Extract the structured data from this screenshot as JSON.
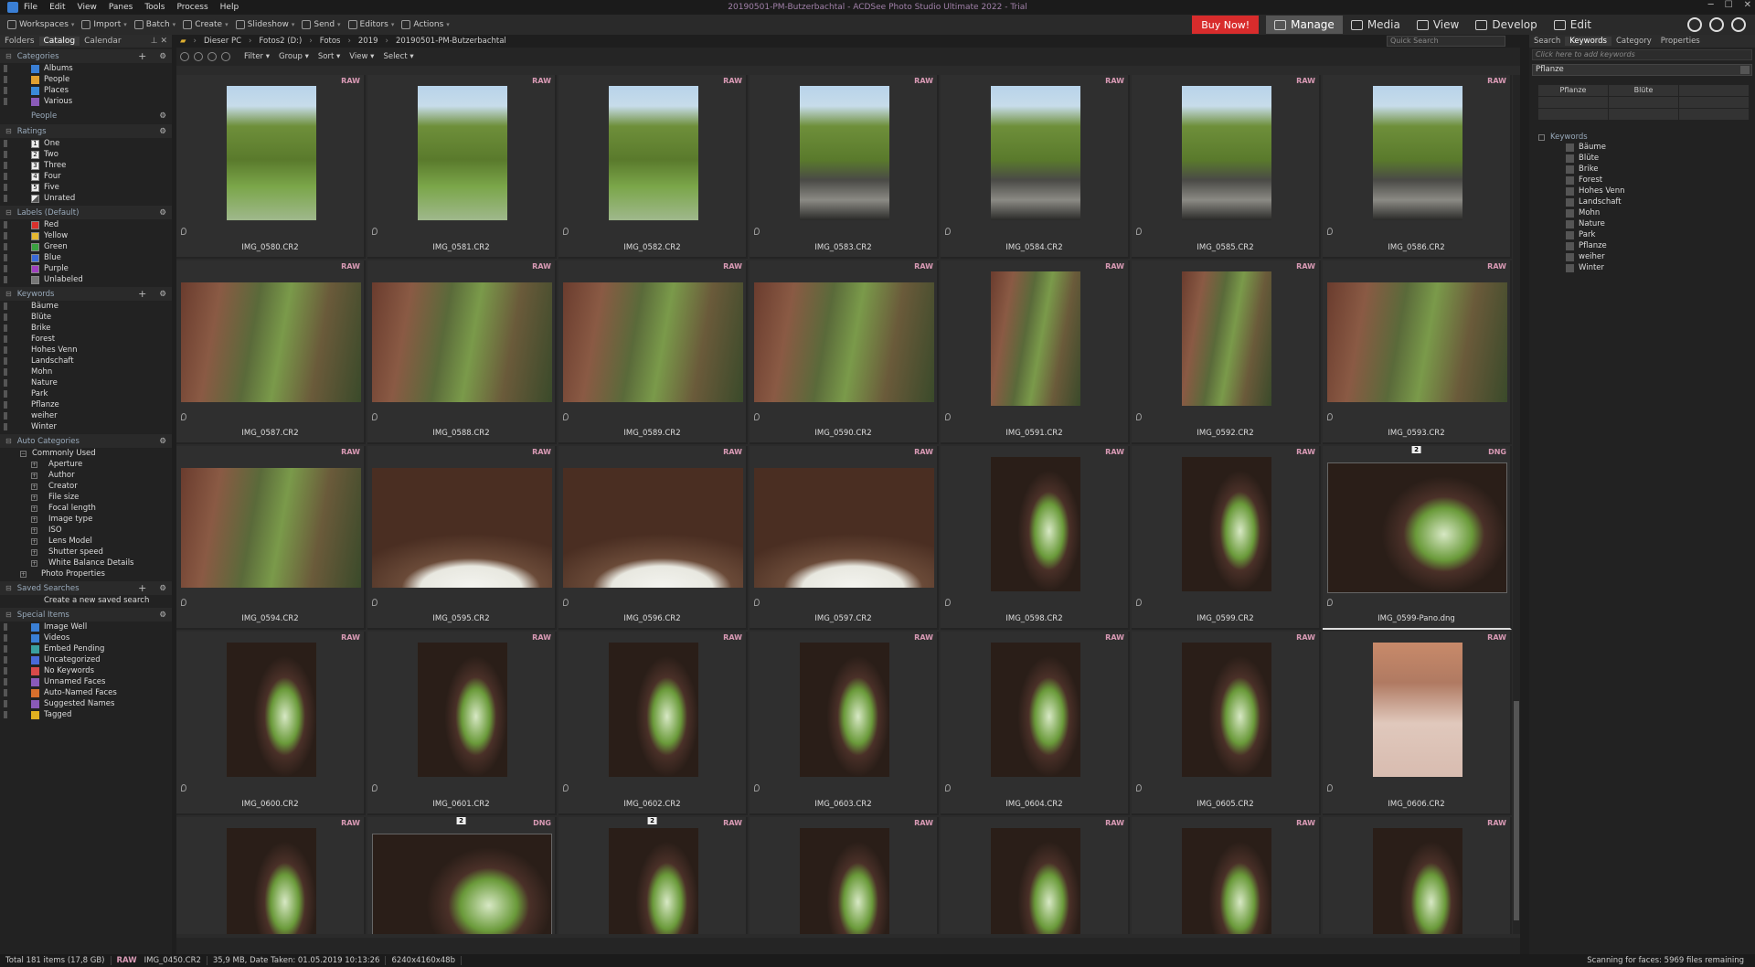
{
  "window": {
    "title": "20190501-PM-Butzerbachtal - ACDSee Photo Studio Ultimate 2022 - Trial",
    "menu": [
      "File",
      "Edit",
      "View",
      "Panes",
      "Tools",
      "Process",
      "Help"
    ]
  },
  "toolbar": {
    "items": [
      "Workspaces",
      "Import",
      "Batch",
      "Create",
      "Slideshow",
      "Send",
      "Editors",
      "Actions"
    ],
    "buy_now": "Buy Now!",
    "modes": [
      "Manage",
      "Media",
      "View",
      "Develop",
      "Edit"
    ],
    "active_mode": "Manage"
  },
  "left_panel": {
    "tabs": [
      "Folders",
      "Catalog",
      "Calendar"
    ],
    "active_tab": "Catalog",
    "categories": {
      "title": "Categories",
      "items": [
        "Albums",
        "People",
        "Places",
        "Various"
      ]
    },
    "people": {
      "title": "People"
    },
    "ratings": {
      "title": "Ratings",
      "items": [
        {
          "num": "1",
          "label": "One"
        },
        {
          "num": "2",
          "label": "Two"
        },
        {
          "num": "3",
          "label": "Three"
        },
        {
          "num": "4",
          "label": "Four"
        },
        {
          "num": "5",
          "label": "Five"
        },
        {
          "num": "",
          "label": "Unrated"
        }
      ]
    },
    "labels": {
      "title": "Labels (Default)",
      "items": [
        {
          "label": "Red",
          "color": "#d9302c"
        },
        {
          "label": "Yellow",
          "color": "#e6b830"
        },
        {
          "label": "Green",
          "color": "#3aa040"
        },
        {
          "label": "Blue",
          "color": "#3a6ad8"
        },
        {
          "label": "Purple",
          "color": "#a040c0"
        },
        {
          "label": "Unlabeled",
          "color": "#777777"
        }
      ]
    },
    "keywords": {
      "title": "Keywords",
      "items": [
        "Bäume",
        "Blüte",
        "Brike",
        "Forest",
        "Hohes Venn",
        "Landschaft",
        "Mohn",
        "Nature",
        "Park",
        "Pflanze",
        "weiher",
        "Winter"
      ]
    },
    "auto_categories": {
      "title": "Auto Categories",
      "group": "Commonly Used",
      "items": [
        "Aperture",
        "Author",
        "Creator",
        "File size",
        "Focal length",
        "Image type",
        "ISO",
        "Lens Model",
        "Shutter speed",
        "White Balance Details"
      ],
      "extra": "Photo Properties"
    },
    "saved_searches": {
      "title": "Saved Searches",
      "items": [
        "Create a new saved search"
      ]
    },
    "special_items": {
      "title": "Special Items",
      "items": [
        "Image Well",
        "Videos",
        "Embed Pending",
        "Uncategorized",
        "No Keywords",
        "Unnamed Faces",
        "Auto-Named Faces",
        "Suggested Names",
        "Tagged"
      ]
    }
  },
  "path": {
    "segments": [
      "Dieser PC",
      "Fotos2 (D:)",
      "Fotos",
      "2019",
      "20190501-PM-Butzerbachtal"
    ],
    "quick_search_placeholder": "Quick Search"
  },
  "filterbar": [
    "Filter",
    "Group",
    "Sort",
    "View",
    "Select"
  ],
  "thumbnails": [
    {
      "name": "IMG_0580.CR2",
      "tag": "RAW",
      "kind": "land",
      "orient": "p"
    },
    {
      "name": "IMG_0581.CR2",
      "tag": "RAW",
      "kind": "land",
      "orient": "p"
    },
    {
      "name": "IMG_0582.CR2",
      "tag": "RAW",
      "kind": "land",
      "orient": "p"
    },
    {
      "name": "IMG_0583.CR2",
      "tag": "RAW",
      "kind": "landrock",
      "orient": "p"
    },
    {
      "name": "IMG_0584.CR2",
      "tag": "RAW",
      "kind": "landrock",
      "orient": "p"
    },
    {
      "name": "IMG_0585.CR2",
      "tag": "RAW",
      "kind": "landrock",
      "orient": "p"
    },
    {
      "name": "IMG_0586.CR2",
      "tag": "RAW",
      "kind": "landrock",
      "orient": "p"
    },
    {
      "name": "IMG_0587.CR2",
      "tag": "RAW",
      "kind": "rock",
      "orient": "l"
    },
    {
      "name": "IMG_0588.CR2",
      "tag": "RAW",
      "kind": "rock",
      "orient": "l"
    },
    {
      "name": "IMG_0589.CR2",
      "tag": "RAW",
      "kind": "rock",
      "orient": "l"
    },
    {
      "name": "IMG_0590.CR2",
      "tag": "RAW",
      "kind": "rock",
      "orient": "l"
    },
    {
      "name": "IMG_0591.CR2",
      "tag": "RAW",
      "kind": "rock",
      "orient": "p"
    },
    {
      "name": "IMG_0592.CR2",
      "tag": "RAW",
      "kind": "rock",
      "orient": "p"
    },
    {
      "name": "IMG_0593.CR2",
      "tag": "RAW",
      "kind": "rock",
      "orient": "l"
    },
    {
      "name": "IMG_0594.CR2",
      "tag": "RAW",
      "kind": "rock",
      "orient": "l"
    },
    {
      "name": "IMG_0595.CR2",
      "tag": "RAW",
      "kind": "arch",
      "orient": "l"
    },
    {
      "name": "IMG_0596.CR2",
      "tag": "RAW",
      "kind": "arch",
      "orient": "l"
    },
    {
      "name": "IMG_0597.CR2",
      "tag": "RAW",
      "kind": "arch",
      "orient": "l"
    },
    {
      "name": "IMG_0598.CR2",
      "tag": "RAW",
      "kind": "cave",
      "orient": "p"
    },
    {
      "name": "IMG_0599.CR2",
      "tag": "RAW",
      "kind": "cave",
      "orient": "p"
    },
    {
      "name": "IMG_0599-Pano.dng",
      "tag": "DNG",
      "badge": "2",
      "kind": "cave",
      "orient": "pano",
      "selected": true
    },
    {
      "name": "IMG_0600.CR2",
      "tag": "RAW",
      "kind": "cave",
      "orient": "p"
    },
    {
      "name": "IMG_0601.CR2",
      "tag": "RAW",
      "kind": "cave",
      "orient": "p"
    },
    {
      "name": "IMG_0602.CR2",
      "tag": "RAW",
      "kind": "cave",
      "orient": "p"
    },
    {
      "name": "IMG_0603.CR2",
      "tag": "RAW",
      "kind": "cave",
      "orient": "p"
    },
    {
      "name": "IMG_0604.CR2",
      "tag": "RAW",
      "kind": "cave",
      "orient": "p"
    },
    {
      "name": "IMG_0605.CR2",
      "tag": "RAW",
      "kind": "cave",
      "orient": "p"
    },
    {
      "name": "IMG_0606.CR2",
      "tag": "RAW",
      "kind": "pink",
      "orient": "p"
    },
    {
      "name": "",
      "tag": "RAW",
      "kind": "cave",
      "orient": "p"
    },
    {
      "name": "",
      "tag": "DNG",
      "badge": "2",
      "kind": "cave",
      "orient": "pano"
    },
    {
      "name": "",
      "tag": "RAW",
      "badge": "2",
      "kind": "cave",
      "orient": "p"
    },
    {
      "name": "",
      "tag": "RAW",
      "kind": "cave",
      "orient": "p"
    },
    {
      "name": "",
      "tag": "RAW",
      "kind": "cave",
      "orient": "p"
    },
    {
      "name": "",
      "tag": "RAW",
      "kind": "cave",
      "orient": "p"
    },
    {
      "name": "",
      "tag": "RAW",
      "kind": "cave",
      "orient": "p"
    }
  ],
  "right_panel": {
    "tabs": [
      "Search",
      "Keywords",
      "Category",
      "Properties"
    ],
    "active_tab": "Keywords",
    "keyword_input_placeholder": "Click here to add keywords",
    "quick_set": "Pflanze",
    "quick_table": [
      "Pflanze",
      "Blüte",
      "",
      "",
      "",
      "",
      "",
      "",
      ""
    ],
    "keywords_title": "Keywords",
    "keywords": [
      "Bäume",
      "Blüte",
      "Brike",
      "Forest",
      "Hohes Venn",
      "Landschaft",
      "Mohn",
      "Nature",
      "Park",
      "Pflanze",
      "weiher",
      "Winter"
    ]
  },
  "status": {
    "total": "Total 181 items  (17,8 GB)",
    "tag": "RAW",
    "file": "IMG_0450.CR2",
    "info": "35,9 MB, Date Taken: 01.05.2019 10:13:26",
    "dims": "6240x4160x48b",
    "right": "Scanning for faces: 5969 files remaining"
  }
}
